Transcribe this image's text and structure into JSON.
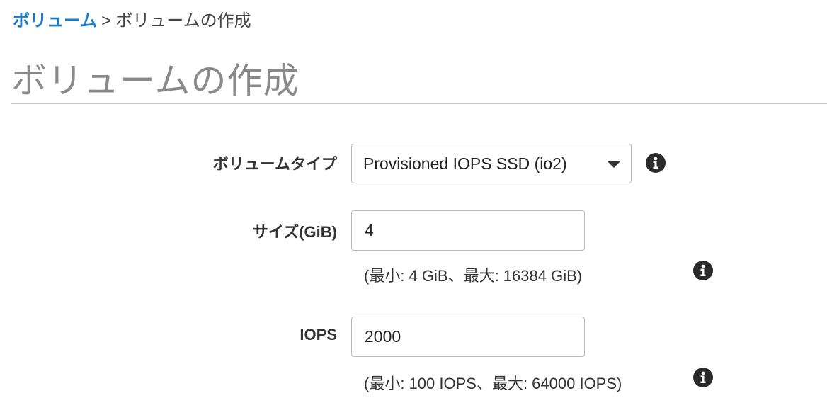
{
  "breadcrumb": {
    "parent": "ボリューム",
    "separator": ">",
    "current": "ボリュームの作成"
  },
  "page_title": "ボリュームの作成",
  "form": {
    "volume_type": {
      "label": "ボリュームタイプ",
      "selected": "Provisioned IOPS SSD (io2)",
      "icon": "info-icon"
    },
    "size": {
      "label": "サイズ(GiB)",
      "value": "4",
      "hint": "(最小: 4 GiB、最大: 16384 GiB)",
      "icon": "info-icon"
    },
    "iops": {
      "label": "IOPS",
      "value": "2000",
      "hint": "(最小: 100 IOPS、最大: 64000 IOPS)",
      "icon": "info-icon"
    }
  },
  "colors": {
    "link": "#1a7ac7",
    "title": "#8a8a8a",
    "border": "#b8b8b8",
    "icon": "#2b2b2b"
  }
}
